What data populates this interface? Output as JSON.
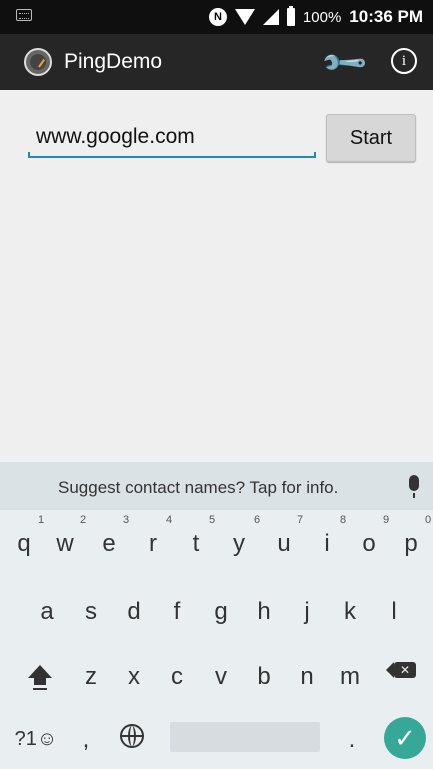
{
  "status_bar": {
    "battery_percent": "100%",
    "time": "10:36 PM",
    "icons": [
      "keyboard-indicator-icon",
      "nfc-icon",
      "wifi-icon",
      "signal-icon",
      "battery-icon"
    ]
  },
  "app_bar": {
    "title": "PingDemo",
    "icons": [
      "app-logo-icon",
      "wrench-icon",
      "info-icon"
    ],
    "info_glyph": "i",
    "wrench_glyph": "🔧"
  },
  "main": {
    "host_input": {
      "value": "www.google.com"
    },
    "start_label": "Start",
    "accent_color": "#1e88b7"
  },
  "keyboard": {
    "suggestion": "Suggest contact names? Tap for info.",
    "row1": [
      {
        "k": "q",
        "hint": "1"
      },
      {
        "k": "w",
        "hint": "2"
      },
      {
        "k": "e",
        "hint": "3"
      },
      {
        "k": "r",
        "hint": "4"
      },
      {
        "k": "t",
        "hint": "5"
      },
      {
        "k": "y",
        "hint": "6"
      },
      {
        "k": "u",
        "hint": "7"
      },
      {
        "k": "i",
        "hint": "8"
      },
      {
        "k": "o",
        "hint": "9"
      },
      {
        "k": "p",
        "hint": "0"
      }
    ],
    "row2": [
      "a",
      "s",
      "d",
      "f",
      "g",
      "h",
      "j",
      "k",
      "l"
    ],
    "row3": [
      "z",
      "x",
      "c",
      "v",
      "b",
      "n",
      "m"
    ],
    "symbols_label": "?1☺",
    "comma_label": ",",
    "period_label": ".",
    "enter_glyph": "✓",
    "enter_color": "#35a897"
  }
}
